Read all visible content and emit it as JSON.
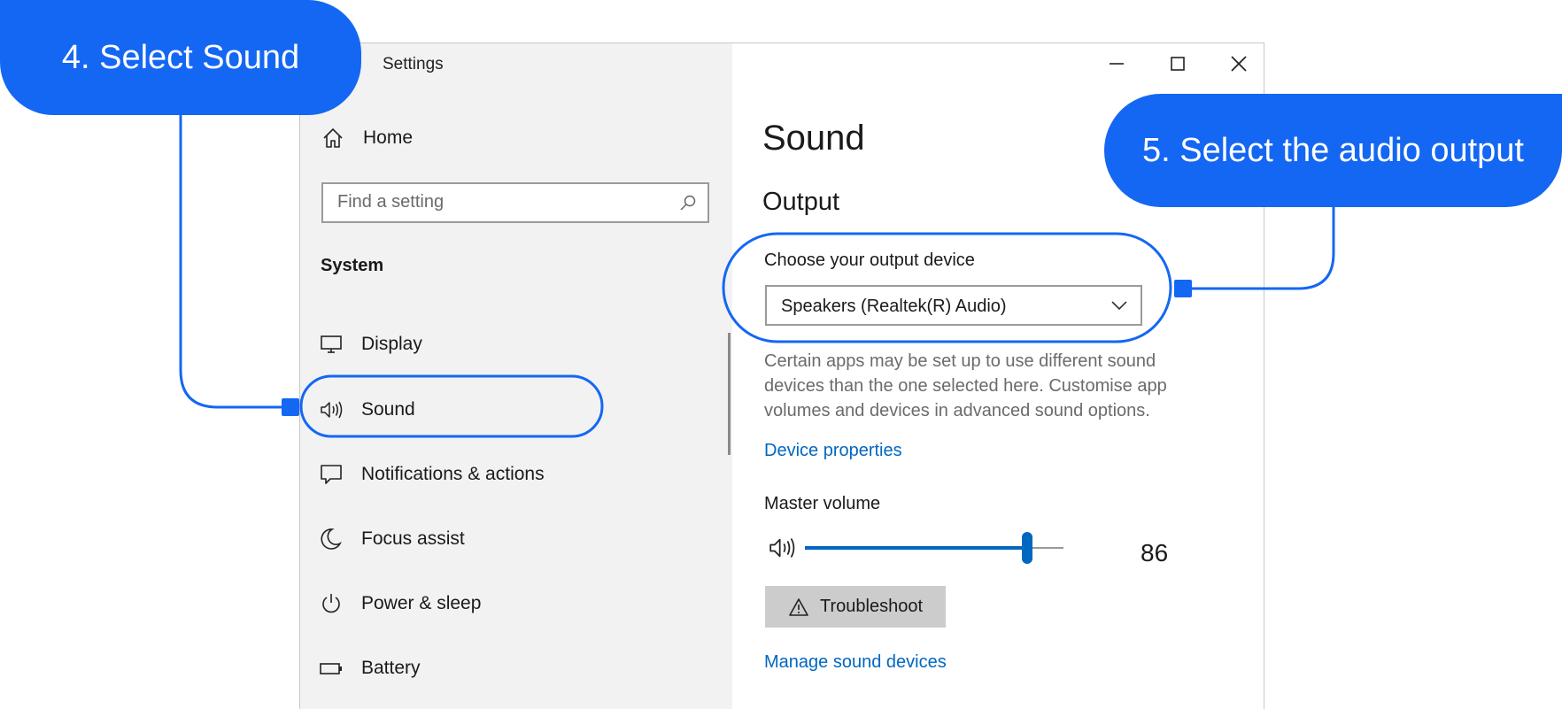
{
  "window": {
    "title": "Settings",
    "controls": {
      "minimize": "minimize-icon",
      "maximize": "maximize-icon",
      "close": "close-icon"
    }
  },
  "sidebar": {
    "home_label": "Home",
    "search_placeholder": "Find a setting",
    "section_title": "System",
    "items": [
      {
        "label": "Display",
        "icon": "monitor-icon"
      },
      {
        "label": "Sound",
        "icon": "speaker-icon",
        "selected": true
      },
      {
        "label": "Notifications & actions",
        "icon": "notification-icon"
      },
      {
        "label": "Focus assist",
        "icon": "moon-icon"
      },
      {
        "label": "Power & sleep",
        "icon": "power-icon"
      },
      {
        "label": "Battery",
        "icon": "battery-icon"
      }
    ]
  },
  "main": {
    "title": "Sound",
    "output_heading": "Output",
    "choose_device_label": "Choose your output device",
    "selected_device": "Speakers (Realtek(R) Audio)",
    "description": [
      "Certain apps may be set up to use different sound",
      "devices than the one selected here. Customise app",
      "volumes and devices in advanced sound options."
    ],
    "device_properties_link": "Device properties",
    "master_volume_label": "Master volume",
    "volume": {
      "value": 86,
      "display": "86"
    },
    "troubleshoot_label": "Troubleshoot",
    "manage_devices_link": "Manage sound devices"
  },
  "annotations": {
    "callout_4": "4. Select Sound",
    "callout_5": "5. Select the audio output",
    "color": "#1467f3"
  }
}
